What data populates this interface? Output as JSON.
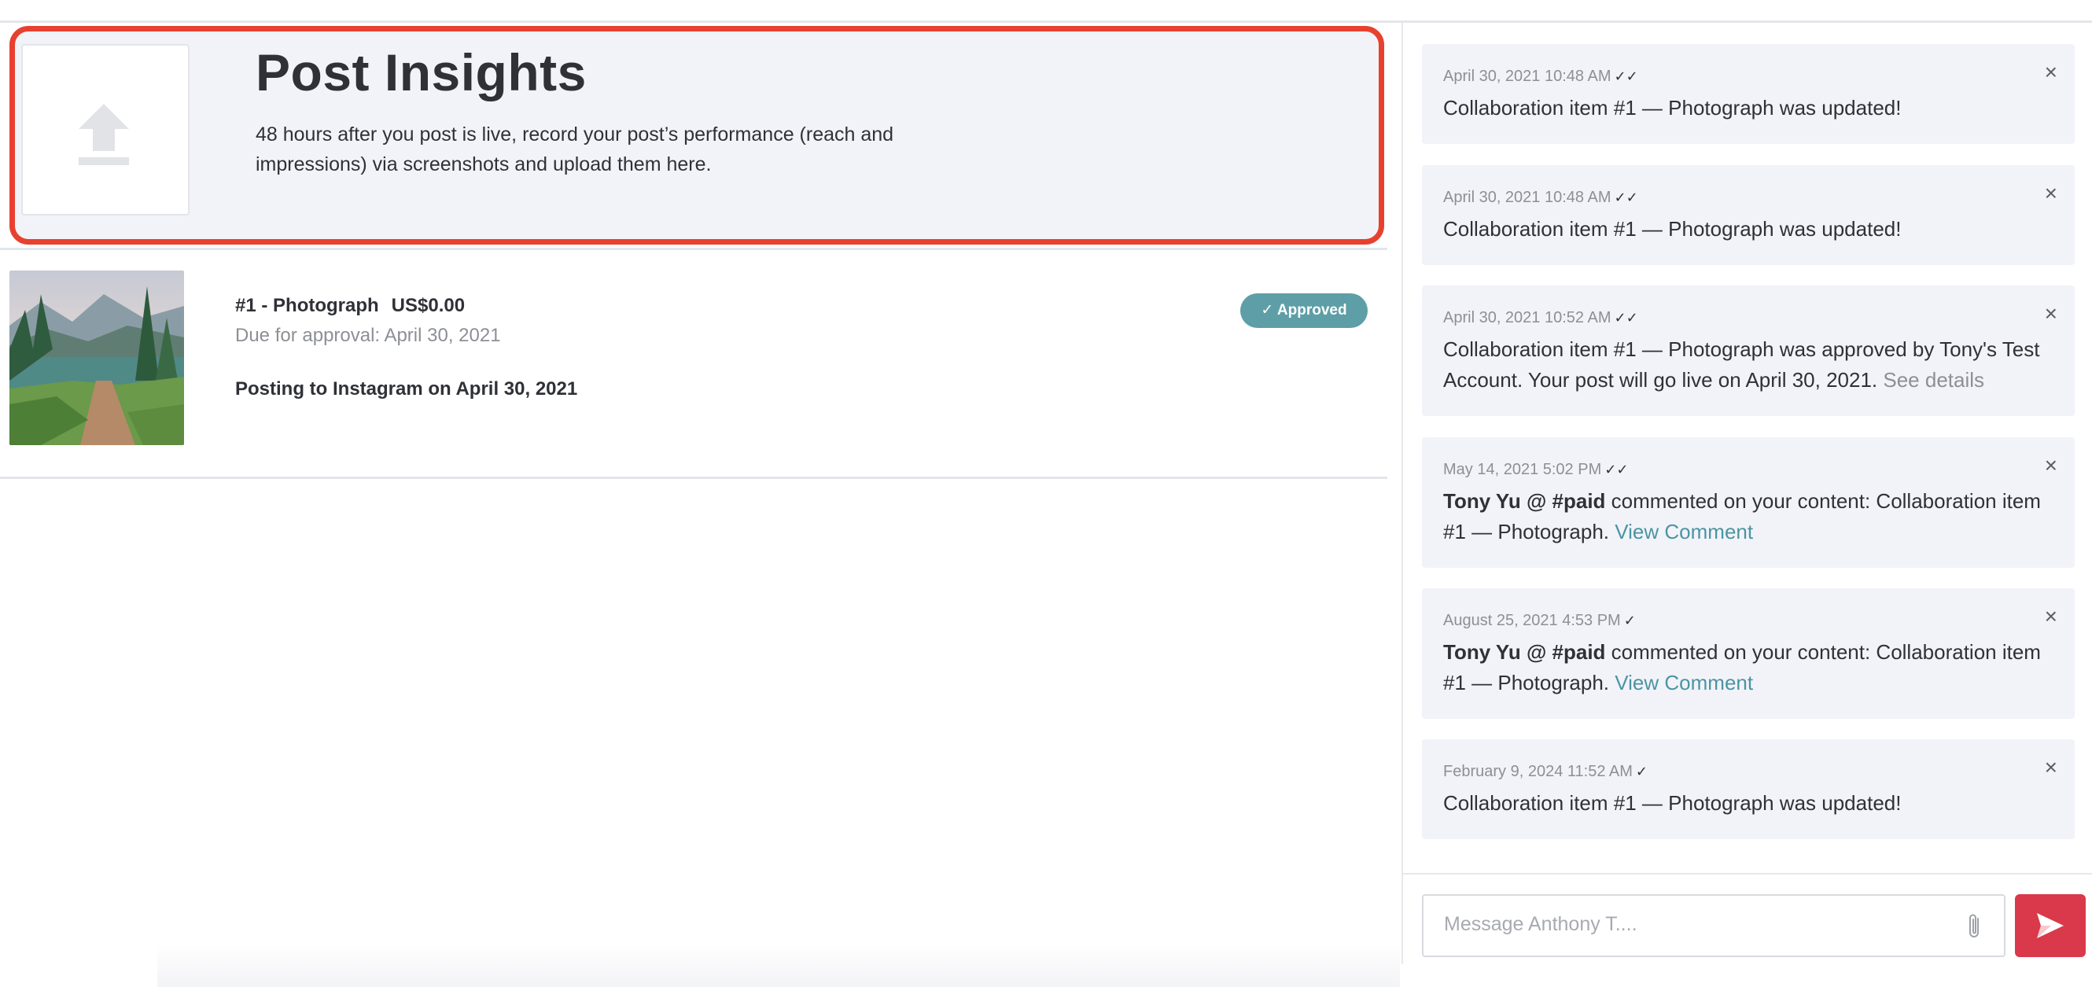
{
  "insights": {
    "title": "Post Insights",
    "description": "48 hours after you post is live, record your post’s performance (reach and impressions) via screenshots and upload them here.",
    "upload_icon": "upload-icon"
  },
  "item": {
    "title": "#1 - Photograph",
    "price": "US$0.00",
    "due": "Due for approval: April 30, 2021",
    "posting": "Posting to Instagram on April 30, 2021",
    "status": "✓ Approved",
    "status_color": "#5e9ea7"
  },
  "notifications": [
    {
      "timestamp": "April 30, 2021 10:48 AM",
      "check": "✓✓",
      "text": "Collaboration item #1 — Photograph was updated!"
    },
    {
      "timestamp": "April 30, 2021 10:48 AM",
      "check": "✓✓",
      "text": "Collaboration item #1 — Photograph was updated!"
    },
    {
      "timestamp": "April 30, 2021 10:52 AM",
      "check": "✓✓",
      "text": "Collaboration item #1 — Photograph was approved by Tony's Test Account. Your post will go live on April 30, 2021.",
      "link": "See details"
    },
    {
      "timestamp": "May 14, 2021 5:02 PM",
      "check": "✓✓",
      "author": "Tony Yu @ #paid",
      "text": "commented on your content: Collaboration item #1 — Photograph.",
      "link": "View Comment"
    },
    {
      "timestamp": "August 25, 2021 4:53 PM",
      "check": "✓",
      "author": "Tony Yu @ #paid",
      "text": "commented on your content: Collaboration item #1 — Photograph.",
      "link": "View Comment"
    },
    {
      "timestamp": "February 9, 2024 11:52 AM",
      "check": "✓",
      "text": "Collaboration item #1 — Photograph was updated!"
    }
  ],
  "close_glyph": "×",
  "composer": {
    "placeholder": "Message Anthony T....",
    "attach_icon": "paperclip-icon",
    "send_icon": "send-icon"
  },
  "colors": {
    "highlight": "#e8402f",
    "link": "#4a95a3",
    "send": "#d9394a"
  }
}
